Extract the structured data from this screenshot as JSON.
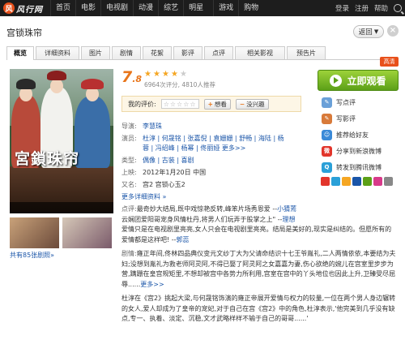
{
  "topbar": {
    "logo_mark": "风",
    "logo_text": "风行网",
    "nav": [
      "首页",
      "电影",
      "电视剧",
      "动漫",
      "综艺",
      "明星",
      "游戏",
      "购物"
    ],
    "user_links": [
      "登录",
      "注册",
      "帮助"
    ]
  },
  "title": "宫锁珠帘",
  "back_label": "返回",
  "close_label": "×",
  "tabs": [
    "概览",
    "详细资料",
    "图片",
    "剧情",
    "花絮",
    "影评",
    "点评",
    "相关影视",
    "预告片"
  ],
  "poster_title": "宮鎖珠帘",
  "rating": {
    "score_int": "7",
    "score_dec": ".8",
    "stars_filled": 4,
    "meta": "6964次评分, 4810人推荐"
  },
  "my_rating": {
    "label": "我的评价:",
    "want_label": "想看",
    "dislike_label": "没兴趣"
  },
  "info": {
    "director_key": "导演:",
    "director": "李慧珠",
    "cast_key": "演员:",
    "cast_line1": "杜淳 | 何晟铭 | 张嘉倪 | 袁姗姗 | 舒畅 | 海陆 | 杨",
    "cast_line2": "蓉 | 冯绍峰 | 杨幂 | 佟丽娅",
    "cast_more": "更多>>",
    "type_key": "类型:",
    "types": "偶像 | 古装 | 喜剧",
    "date_key": "上映:",
    "date": "2012年1月20日  中国",
    "alias_key": "又名:",
    "alias": "宫2  宫锁心玉2",
    "more_details": "更多详细资料 »"
  },
  "side": {
    "watch_label": "立即观看",
    "new_badge": "高清",
    "items": [
      "写点评",
      "写影评",
      "推荐给好友",
      "分享到新浪微博",
      "转发到腾讯微博"
    ]
  },
  "stills_link": "共有85张剧照»",
  "synopsis": {
    "p1_label": "点评:",
    "p1": "最奇妙大结局,既中戏惊艳反转,峰笨片场秀恩爱 --",
    "p1_user": "小猜蔫",
    "p2": "云娴团爱阳哥宠身风情杜丹,将男人们玩弄于股掌之上\" --",
    "p2_user": "理想",
    "p3": "爱情只是在电视剧里亮亮,女人只会在电视剧里亮亮。结局是美好的,现实是纠结的。但愿所有的爱情都是这样吧! --",
    "p3_user": "郭蕊",
    "plot_label": "剧情:",
    "plot": "雍正年间,佟林四品典仪变元文纱丁大为父请命结识十七王爷胤礼,二人两情依依,本要结为夫妇;没想到胤礼为救老师阿灵阿,不得已娶了阿灵阿之女嘉嘉为妻,伤心欲绝的婉儿在宫室里步步为营,蹒跚在皇宫规矩里,不想却被宫中各势力所利用,宫室在宫中的丫头地位也因此上升,卫臻受尽屈辱......",
    "plot_more": "更多>>",
    "review": "杜淳在《宫2》挑起大梁,与何晟铭饰演的雍正帝展开爱情与权力的较量,一位在两个男人身边辗转的女人,爱人却成为了皇帝的宠妃,对于自己在宫《宫2》中的角色,杜淳表示,'他完美到几乎没有缺点,专一、执着、淡定、沉稳,文才武略样样不输于自己的哥哥......'"
  }
}
